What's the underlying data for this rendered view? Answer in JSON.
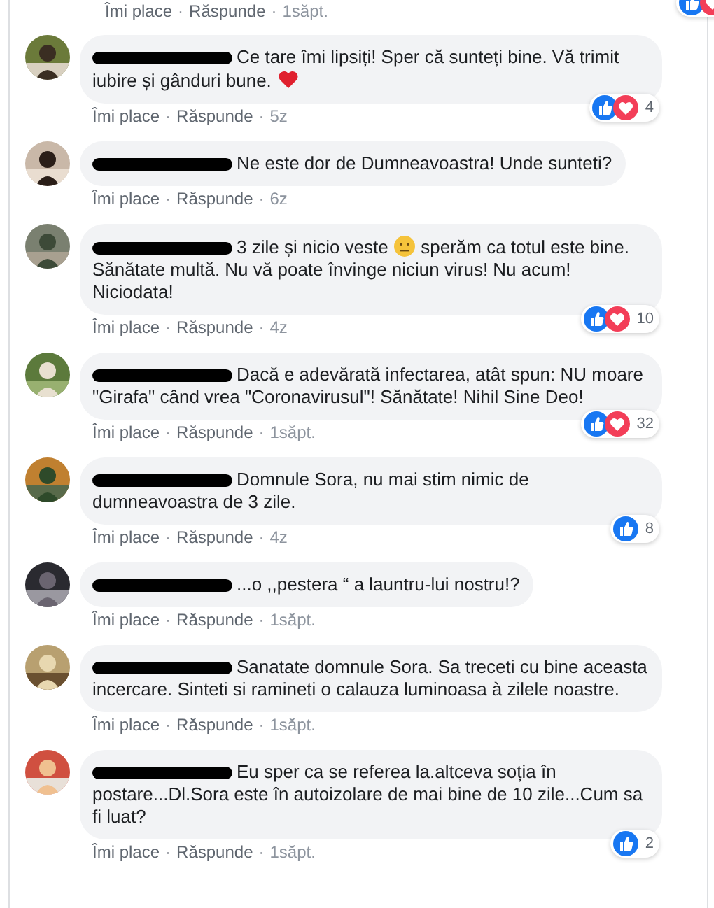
{
  "top_meta": {
    "items": [
      {
        "kind": "link",
        "text": "Îmi place"
      },
      {
        "kind": "sep",
        "text": "·"
      },
      {
        "kind": "link",
        "text": "Răspunde"
      },
      {
        "kind": "sep",
        "text": "·"
      },
      {
        "kind": "time",
        "text": "1săpt."
      }
    ],
    "reactions": {
      "kinds": [
        {
          "kind": "like"
        },
        {
          "kind": "love"
        }
      ]
    }
  },
  "comments": [
    {
      "author": {
        "redacted": true
      },
      "parts": [
        {
          "kind": "text",
          "text": "Ce tare îmi lipsiți! Sper că sunteți bine. Vă trimit iubire și gânduri bune. "
        },
        {
          "kind": "heart"
        }
      ],
      "reactions": {
        "kinds": [
          {
            "kind": "like"
          },
          {
            "kind": "love"
          }
        ],
        "count": "4"
      },
      "meta": [
        {
          "kind": "link",
          "text": "Îmi place"
        },
        {
          "kind": "sep",
          "text": "·"
        },
        {
          "kind": "link",
          "text": "Răspunde"
        },
        {
          "kind": "sep",
          "text": "·"
        },
        {
          "kind": "time",
          "text": "5z"
        }
      ]
    },
    {
      "author": {
        "redacted": true
      },
      "parts": [
        {
          "kind": "text",
          "text": "Ne este dor de Dumneavoastra! Unde sunteti?"
        }
      ],
      "meta": [
        {
          "kind": "link",
          "text": "Îmi place"
        },
        {
          "kind": "sep",
          "text": "·"
        },
        {
          "kind": "link",
          "text": "Răspunde"
        },
        {
          "kind": "sep",
          "text": "·"
        },
        {
          "kind": "time",
          "text": "6z"
        }
      ]
    },
    {
      "author": {
        "redacted": true
      },
      "parts": [
        {
          "kind": "text",
          "text": "3 zile și nicio veste "
        },
        {
          "kind": "face"
        },
        {
          "kind": "text",
          "text": " sperăm ca totul este bine. Sănătate multă. Nu vă poate învinge niciun virus! Nu acum! Niciodata!"
        }
      ],
      "reactions": {
        "kinds": [
          {
            "kind": "like"
          },
          {
            "kind": "love"
          }
        ],
        "count": "10"
      },
      "meta": [
        {
          "kind": "link",
          "text": "Îmi place"
        },
        {
          "kind": "sep",
          "text": "·"
        },
        {
          "kind": "link",
          "text": "Răspunde"
        },
        {
          "kind": "sep",
          "text": "·"
        },
        {
          "kind": "time",
          "text": "4z"
        }
      ]
    },
    {
      "author": {
        "redacted": true
      },
      "parts": [
        {
          "kind": "text",
          "text": "Dacă e adevărată infectarea, atât spun: NU moare \"Girafa\" când vrea \"Coronavirusul\"! Sănătate! Nihil Sine Deo!"
        }
      ],
      "reactions": {
        "kinds": [
          {
            "kind": "like"
          },
          {
            "kind": "love"
          }
        ],
        "count": "32"
      },
      "meta": [
        {
          "kind": "link",
          "text": "Îmi place"
        },
        {
          "kind": "sep",
          "text": "·"
        },
        {
          "kind": "link",
          "text": "Răspunde"
        },
        {
          "kind": "sep",
          "text": "·"
        },
        {
          "kind": "time",
          "text": "1săpt."
        }
      ]
    },
    {
      "author": {
        "redacted": true
      },
      "parts": [
        {
          "kind": "text",
          "text": "Domnule Sora, nu mai stim nimic de dumneavoastra de 3 zile."
        }
      ],
      "reactions": {
        "kinds": [
          {
            "kind": "like"
          }
        ],
        "count": "8"
      },
      "meta": [
        {
          "kind": "link",
          "text": "Îmi place"
        },
        {
          "kind": "sep",
          "text": "·"
        },
        {
          "kind": "link",
          "text": "Răspunde"
        },
        {
          "kind": "sep",
          "text": "·"
        },
        {
          "kind": "time",
          "text": "4z"
        }
      ]
    },
    {
      "author": {
        "redacted": true
      },
      "parts": [
        {
          "kind": "text",
          "text": "...o ,,pestera “ a launtru-lui nostru!?"
        }
      ],
      "meta": [
        {
          "kind": "link",
          "text": "Îmi place"
        },
        {
          "kind": "sep",
          "text": "·"
        },
        {
          "kind": "link",
          "text": "Răspunde"
        },
        {
          "kind": "sep",
          "text": "·"
        },
        {
          "kind": "time",
          "text": "1săpt."
        }
      ]
    },
    {
      "author": {
        "redacted": true
      },
      "parts": [
        {
          "kind": "text",
          "text": "Sanatate domnule Sora. Sa treceti cu bine aceasta incercare. Sinteti si ramineti o calauza luminoasa à zilele noastre."
        }
      ],
      "meta": [
        {
          "kind": "link",
          "text": "Îmi place"
        },
        {
          "kind": "sep",
          "text": "·"
        },
        {
          "kind": "link",
          "text": "Răspunde"
        },
        {
          "kind": "sep",
          "text": "·"
        },
        {
          "kind": "time",
          "text": "1săpt."
        }
      ]
    },
    {
      "author": {
        "redacted": true
      },
      "parts": [
        {
          "kind": "text",
          "text": "Eu sper ca se referea la.altceva soția în postare...Dl.Sora este în autoizolare de mai bine de 10 zile...Cum sa fi luat?"
        }
      ],
      "reactions": {
        "kinds": [
          {
            "kind": "like"
          }
        ],
        "count": "2"
      },
      "meta": [
        {
          "kind": "link",
          "text": "Îmi place"
        },
        {
          "kind": "sep",
          "text": "·"
        },
        {
          "kind": "link",
          "text": "Răspunde"
        },
        {
          "kind": "sep",
          "text": "·"
        },
        {
          "kind": "time",
          "text": "1săpt."
        }
      ]
    }
  ]
}
